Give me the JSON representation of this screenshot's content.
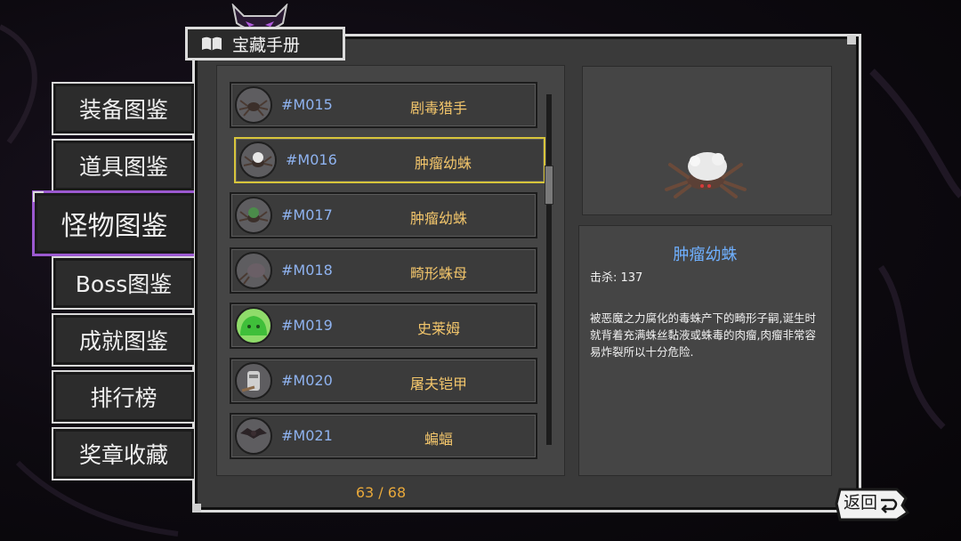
{
  "header": {
    "title": "宝藏手册"
  },
  "sidebar": {
    "items": [
      {
        "label": "装备图鉴",
        "active": false
      },
      {
        "label": "道具图鉴",
        "active": false
      },
      {
        "label": "怪物图鉴",
        "active": true
      },
      {
        "label": "Boss图鉴",
        "active": false
      },
      {
        "label": "成就图鉴",
        "active": false
      },
      {
        "label": "排行榜",
        "active": false
      },
      {
        "label": "奖章收藏",
        "active": false
      }
    ]
  },
  "monster_list": [
    {
      "id": "#M015",
      "name": "剧毒猎手",
      "icon": "spider-icon"
    },
    {
      "id": "#M016",
      "name": "肿瘤幼蛛",
      "icon": "tumor-spider-icon",
      "selected": true
    },
    {
      "id": "#M017",
      "name": "肿瘤幼蛛",
      "icon": "green-tumor-spider-icon"
    },
    {
      "id": "#M018",
      "name": "畸形蛛母",
      "icon": "spider-mother-icon"
    },
    {
      "id": "#M019",
      "name": "史莱姆",
      "icon": "slime-icon"
    },
    {
      "id": "#M020",
      "name": "屠夫铠甲",
      "icon": "armor-icon"
    },
    {
      "id": "#M021",
      "name": "蝙蝠",
      "icon": "bat-icon"
    }
  ],
  "detail": {
    "name": "肿瘤幼蛛",
    "kills": "击杀: 137",
    "description": "被恶魔之力腐化的毒蛛产下的畸形子嗣,诞生时就背着充满蛛丝黏液或蛛毒的肉瘤,肉瘤非常容易炸裂所以十分危险."
  },
  "pagination": {
    "text": "63 / 68"
  },
  "back_button": {
    "label": "返回"
  },
  "colors": {
    "accent_active_tab": "#9b59d0",
    "selected_row": "#d8c53b",
    "id_text": "#8fb3f0",
    "name_text": "#f2c56b",
    "detail_name": "#6fb0ff",
    "page_count": "#e8a83a"
  }
}
